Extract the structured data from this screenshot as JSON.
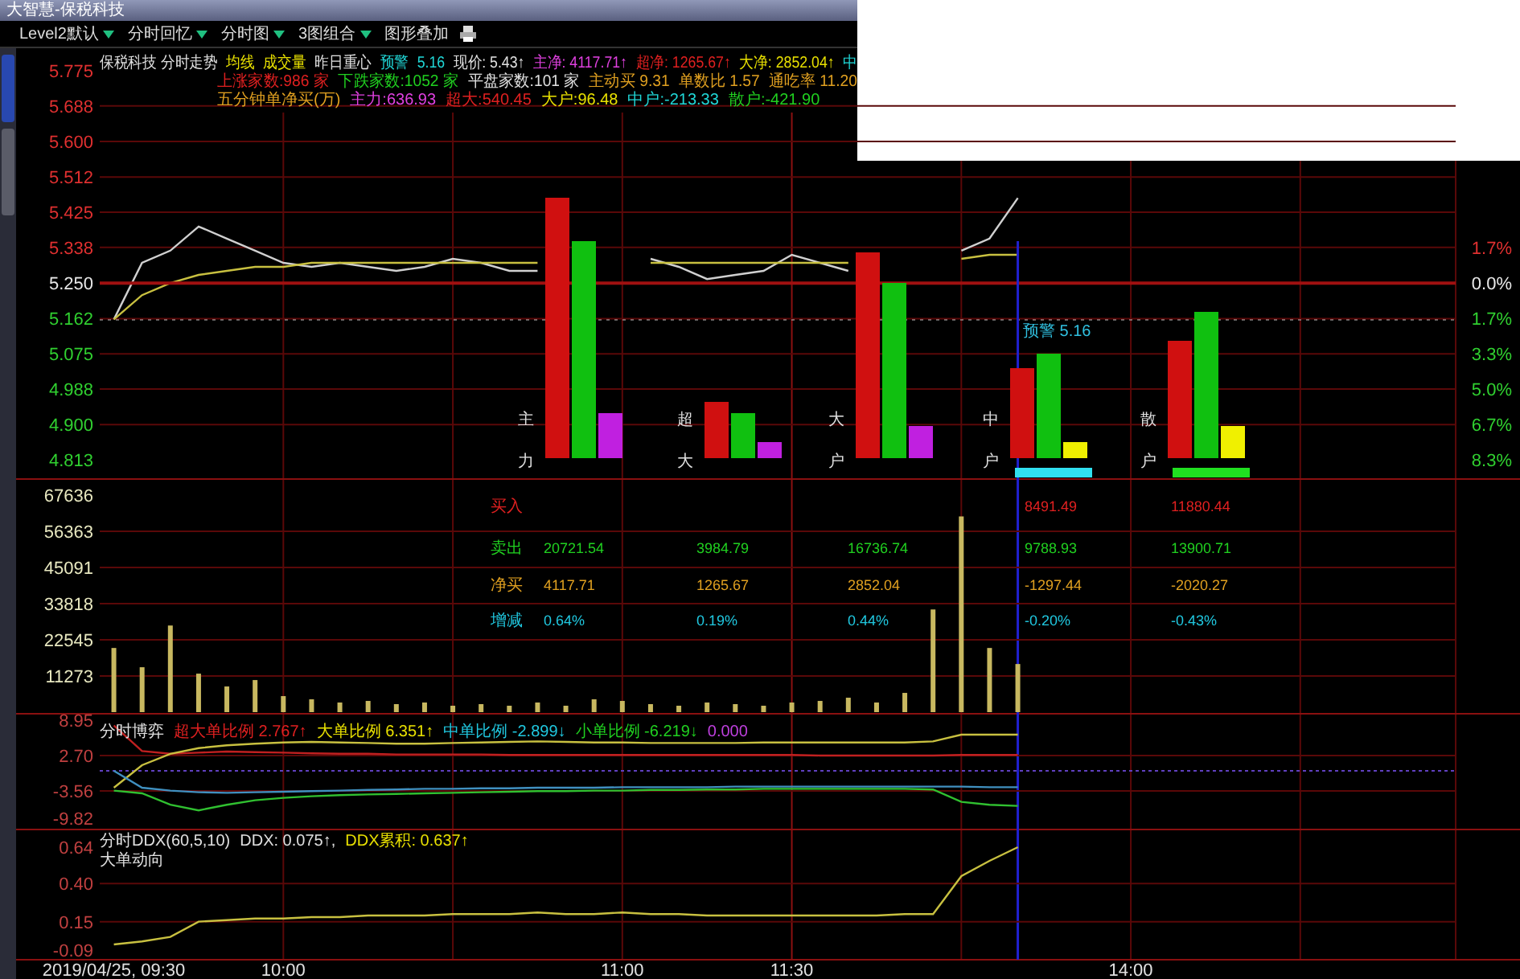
{
  "window": {
    "title": "大智慧-保税科技"
  },
  "toolbar": {
    "items": [
      {
        "label": "Level2默认",
        "dropdown": true
      },
      {
        "label": "分时回忆",
        "dropdown": true
      },
      {
        "label": "分时图",
        "dropdown": true
      },
      {
        "label": "3图组合",
        "dropdown": true
      },
      {
        "label": "图形叠加",
        "dropdown": false
      }
    ]
  },
  "side_tabs": [
    {
      "selected": true
    },
    {
      "selected": false
    }
  ],
  "header": {
    "line_1": [
      {
        "text": "保税科技 分时走势",
        "color": "#e0e0e0"
      },
      {
        "text": "均线",
        "color": "#e8e000"
      },
      {
        "text": "成交量",
        "color": "#e8e000"
      },
      {
        "text": "昨日重心",
        "color": "#e0e0e0"
      },
      {
        "text": "预警",
        "color": "#20d8d8"
      },
      {
        "text": "5.16",
        "color": "#20d8d8"
      },
      {
        "text": "现价: 5.43↑",
        "color": "#e0e0e0"
      },
      {
        "text": "主净: 4117.71↑",
        "color": "#e040e0"
      },
      {
        "text": "超净: 1265.67↑",
        "color": "#e02020"
      },
      {
        "text": "大净: 2852.04↑",
        "color": "#e8e000"
      },
      {
        "text": "中",
        "color": "#20d8d8"
      }
    ],
    "line_2": [
      {
        "text": "上涨家数:986 家",
        "color": "#e02020"
      },
      {
        "text": "下跌家数:1052 家",
        "color": "#20d020"
      },
      {
        "text": "平盘家数:101 家",
        "color": "#e0e0e0"
      },
      {
        "text": "主动买 9.31",
        "color": "#e0a020"
      },
      {
        "text": "单数比 1.57",
        "color": "#e0a020"
      },
      {
        "text": "通吃率 11.20",
        "color": "#e0a020"
      }
    ],
    "line_3": [
      {
        "text": "五分钟单净买(万)",
        "color": "#e0a020"
      },
      {
        "text": "主力:636.93",
        "color": "#e040e0"
      },
      {
        "text": "超大:540.45",
        "color": "#e02020"
      },
      {
        "text": "大户:96.48",
        "color": "#e8e000"
      },
      {
        "text": "中户:-213.33",
        "color": "#20d8d8"
      },
      {
        "text": "散户:-421.90",
        "color": "#20d020"
      }
    ]
  },
  "price_panel": {
    "tick_colors": [
      {
        "color": "#e03030"
      },
      {
        "color": "#e03030"
      },
      {
        "color": "#e03030"
      },
      {
        "color": "#e03030"
      },
      {
        "color": "#e03030"
      },
      {
        "color": "#e03030"
      },
      {
        "color": "#e8e8e8"
      },
      {
        "color": "#30d030"
      },
      {
        "color": "#30d030"
      },
      {
        "color": "#30d030"
      },
      {
        "color": "#30d030"
      },
      {
        "color": "#30d030"
      }
    ],
    "change_labels": [
      {
        "label": "1.7%",
        "color": "#e03030"
      },
      {
        "label": "0.0%",
        "color": "#e8e8e8"
      },
      {
        "label": "1.7%",
        "color": "#30d030"
      },
      {
        "label": "3.3%",
        "color": "#30d030"
      },
      {
        "label": "5.0%",
        "color": "#30d030"
      },
      {
        "label": "6.7%",
        "color": "#30d030"
      },
      {
        "label": "8.3%",
        "color": "#30d030"
      }
    ],
    "alert_label": "预警 5.16",
    "chart_data": {
      "type": "line",
      "categories": [
        null,
        null,
        null,
        null,
        null,
        null,
        null,
        null,
        null,
        null,
        null,
        null,
        null,
        null,
        null,
        null,
        null,
        null,
        null,
        null,
        null,
        null,
        null,
        null,
        null,
        null,
        null,
        null,
        null,
        null,
        null,
        null,
        null,
        null,
        null,
        null,
        null,
        null,
        null,
        null,
        null,
        null,
        null,
        null,
        null,
        null,
        null,
        null
      ],
      "ylim": [
        4.813,
        5.775
      ],
      "grid": true,
      "yticks": [
        {
          "value": 5.775,
          "label": "5.775"
        },
        {
          "value": 5.688,
          "label": "5.688"
        },
        {
          "value": 5.6,
          "label": "5.600"
        },
        {
          "value": 5.512,
          "label": "5.512"
        },
        {
          "value": 5.425,
          "label": "5.425"
        },
        {
          "value": 5.338,
          "label": "5.338"
        },
        {
          "value": 5.25,
          "label": "5.250"
        },
        {
          "value": 5.162,
          "label": "5.162"
        },
        {
          "value": 5.075,
          "label": "5.075"
        },
        {
          "value": 4.988,
          "label": "4.988"
        },
        {
          "value": 4.9,
          "label": "4.900"
        },
        {
          "value": 4.813,
          "label": "4.813"
        }
      ],
      "series": [
        {
          "color": "#d0d0d0",
          "values": [
            5.16,
            5.3,
            5.33,
            5.39,
            5.36,
            5.33,
            5.3,
            5.29,
            5.3,
            5.29,
            5.28,
            5.29,
            5.31,
            5.3,
            5.28,
            5.28,
            null,
            null,
            null,
            5.31,
            5.29,
            5.26,
            5.27,
            5.28,
            5.32,
            5.3,
            5.28,
            null,
            null,
            null,
            5.33,
            5.36,
            5.46,
            null,
            null,
            null,
            null,
            null,
            null,
            null,
            null,
            null,
            null,
            null,
            null,
            null,
            null,
            null
          ]
        },
        {
          "color": "#c8c040",
          "values": [
            5.16,
            5.22,
            5.25,
            5.27,
            5.28,
            5.29,
            5.29,
            5.3,
            5.3,
            5.3,
            5.3,
            5.3,
            5.3,
            5.3,
            5.3,
            5.3,
            null,
            null,
            null,
            5.3,
            5.3,
            5.3,
            5.3,
            5.3,
            5.3,
            5.3,
            5.3,
            null,
            null,
            null,
            5.31,
            5.32,
            5.32,
            null,
            null,
            null,
            null,
            null,
            null,
            null,
            null,
            null,
            null,
            null,
            null,
            null,
            null,
            null
          ]
        }
      ]
    }
  },
  "funds_overlay": {
    "groups": [
      {
        "top": "主",
        "bottom": "力"
      },
      {
        "top": "超",
        "bottom": "大"
      },
      {
        "top": "大",
        "bottom": "户"
      },
      {
        "top": "中",
        "bottom": "户"
      },
      {
        "top": "散",
        "bottom": "户"
      }
    ],
    "table": [
      {
        "label": "买入",
        "kind": "buy",
        "cells": [
          null,
          null,
          null,
          "8491.49",
          "11880.44"
        ]
      },
      {
        "label": "卖出",
        "kind": "sell",
        "cells": [
          "20721.54",
          "3984.79",
          "16736.74",
          "9788.93",
          "13900.71"
        ]
      },
      {
        "label": "净买",
        "kind": "net",
        "cells": [
          "4117.71",
          "1265.67",
          "2852.04",
          "-1297.44",
          "-2020.27"
        ]
      },
      {
        "label": "增减",
        "kind": "change",
        "cells": [
          "0.64%",
          "0.19%",
          "0.44%",
          "-0.20%",
          "-0.43%"
        ]
      }
    ]
  },
  "volume_panel": {
    "chart_data": {
      "type": "bar",
      "categories": [
        null,
        null,
        null,
        null,
        null,
        null,
        null,
        null,
        null,
        null,
        null,
        null,
        null,
        null,
        null,
        null,
        null,
        null,
        null,
        null,
        null,
        null,
        null,
        null,
        null,
        null,
        null,
        null,
        null,
        null,
        null,
        null,
        null,
        null,
        null,
        null,
        null,
        null,
        null,
        null,
        null,
        null,
        null,
        null,
        null,
        null,
        null,
        null
      ],
      "ylim": [
        0,
        67636
      ],
      "grid": true,
      "yticks": [
        67636,
        56363,
        45091,
        33818,
        22545,
        11273
      ],
      "values": [
        20000,
        14000,
        27000,
        12000,
        8000,
        10000,
        5000,
        4000,
        3000,
        3500,
        2500,
        3000,
        2000,
        2500,
        2000,
        3000,
        2000,
        4000,
        3500,
        2500,
        2000,
        3000,
        2500,
        2000,
        3000,
        3500,
        4500,
        3000,
        6000,
        32000,
        61000,
        20000,
        15000,
        null,
        null,
        null,
        null,
        null,
        null,
        null,
        null,
        null,
        null,
        null,
        null,
        null,
        null,
        null
      ]
    }
  },
  "game_panel": {
    "legend": [
      {
        "text": "分时博弈",
        "color": "#e0e0e0"
      },
      {
        "text": "超大单比例 2.767↑",
        "color": "#e02020"
      },
      {
        "text": "大单比例 6.351↑",
        "color": "#e8e000"
      },
      {
        "text": "中单比例 -2.899↓",
        "color": "#20c8e0"
      },
      {
        "text": "小单比例 -6.219↓",
        "color": "#20d020"
      },
      {
        "text": "0.000",
        "color": "#c040e0"
      }
    ],
    "chart_data": {
      "type": "line",
      "categories": [
        null,
        null,
        null,
        null,
        null,
        null,
        null,
        null,
        null,
        null,
        null,
        null,
        null,
        null,
        null,
        null,
        null,
        null,
        null,
        null,
        null,
        null,
        null,
        null,
        null,
        null,
        null,
        null,
        null,
        null,
        null,
        null,
        null,
        null,
        null,
        null,
        null,
        null,
        null,
        null,
        null,
        null,
        null,
        null,
        null,
        null,
        null,
        null
      ],
      "ylim": [
        -9.82,
        8.95
      ],
      "grid": true,
      "yticks": [
        {
          "value": 8.95,
          "label": "8.95"
        },
        {
          "value": 2.7,
          "label": "2.70"
        },
        {
          "value": -3.56,
          "label": "-3.56"
        },
        {
          "value": -9.82,
          "label": "-9.82"
        }
      ],
      "series": [
        {
          "color": "#c02020",
          "values": [
            8.0,
            3.5,
            3.0,
            3.2,
            3.4,
            3.3,
            3.2,
            3.1,
            3.0,
            3.0,
            2.9,
            2.9,
            2.9,
            2.9,
            2.8,
            2.8,
            2.8,
            2.8,
            2.8,
            2.8,
            2.8,
            2.8,
            2.8,
            2.8,
            2.8,
            2.7,
            2.7,
            2.7,
            2.7,
            2.7,
            2.8,
            2.8,
            2.8,
            null,
            null,
            null,
            null,
            null,
            null,
            null,
            null,
            null,
            null,
            null,
            null,
            null,
            null,
            null
          ]
        },
        {
          "color": "#c8c040",
          "values": [
            -3.0,
            1.0,
            3.0,
            4.0,
            4.5,
            4.8,
            5.0,
            5.1,
            5.0,
            4.9,
            4.8,
            4.8,
            4.9,
            5.0,
            5.1,
            5.2,
            5.1,
            5.0,
            5.0,
            4.9,
            4.9,
            4.9,
            4.9,
            5.0,
            5.0,
            5.0,
            5.0,
            5.0,
            5.0,
            5.2,
            6.4,
            6.4,
            6.4,
            null,
            null,
            null,
            null,
            null,
            null,
            null,
            null,
            null,
            null,
            null,
            null,
            null,
            null,
            null
          ]
        },
        {
          "color": "#4090c0",
          "values": [
            0,
            -3.0,
            -3.5,
            -3.8,
            -3.9,
            -3.8,
            -3.7,
            -3.6,
            -3.5,
            -3.4,
            -3.3,
            -3.2,
            -3.2,
            -3.1,
            -3.1,
            -3.0,
            -3.0,
            -3.0,
            -2.9,
            -2.9,
            -2.9,
            -2.9,
            -2.8,
            -2.8,
            -2.8,
            -2.8,
            -2.8,
            -2.8,
            -2.8,
            -2.8,
            -2.8,
            -2.9,
            -2.9,
            null,
            null,
            null,
            null,
            null,
            null,
            null,
            null,
            null,
            null,
            null,
            null,
            null,
            null,
            null
          ]
        },
        {
          "color": "#30c030",
          "values": [
            -3.5,
            -4.0,
            -6.0,
            -7.0,
            -6.0,
            -5.2,
            -4.8,
            -4.5,
            -4.3,
            -4.2,
            -4.1,
            -4.0,
            -3.9,
            -3.8,
            -3.7,
            -3.6,
            -3.6,
            -3.5,
            -3.5,
            -3.4,
            -3.4,
            -3.3,
            -3.3,
            -3.2,
            -3.2,
            -3.2,
            -3.2,
            -3.2,
            -3.2,
            -3.3,
            -5.5,
            -6.0,
            -6.2,
            null,
            null,
            null,
            null,
            null,
            null,
            null,
            null,
            null,
            null,
            null,
            null,
            null,
            null,
            null
          ]
        }
      ]
    }
  },
  "ddx_panel": {
    "legend": [
      {
        "text": "分时DDX(60,5,10)",
        "color": "#e0e0e0"
      },
      {
        "text": "DDX: 0.075↑,",
        "color": "#e0e0e0"
      },
      {
        "text": "DDX累积: 0.637↑",
        "color": "#e8e000"
      }
    ],
    "subtitle": "大单动向",
    "chart_data": {
      "type": "line",
      "categories": [
        "2019/04/25, 09:30",
        null,
        null,
        null,
        null,
        null,
        "10:00",
        null,
        null,
        null,
        null,
        null,
        null,
        null,
        null,
        null,
        null,
        null,
        "11:00",
        null,
        null,
        null,
        null,
        null,
        "11:30",
        null,
        null,
        null,
        null,
        null,
        null,
        null,
        null,
        null,
        null,
        null,
        "14:00",
        null,
        null,
        null,
        null,
        null,
        null,
        null,
        null,
        null,
        null,
        null
      ],
      "ylim": [
        -0.09,
        0.64
      ],
      "grid": true,
      "yticks": [
        {
          "value": 0.64,
          "label": "0.64"
        },
        {
          "value": 0.4,
          "label": "0.40"
        },
        {
          "value": 0.15,
          "label": "0.15"
        },
        {
          "value": -0.09,
          "label": "-0.09"
        }
      ],
      "series": [
        {
          "color": "#c8c040",
          "values": [
            0.0,
            0.02,
            0.05,
            0.15,
            0.16,
            0.17,
            0.17,
            0.18,
            0.18,
            0.19,
            0.19,
            0.19,
            0.2,
            0.2,
            0.2,
            0.21,
            0.2,
            0.2,
            0.21,
            0.2,
            0.2,
            0.19,
            0.19,
            0.19,
            0.19,
            0.19,
            0.19,
            0.19,
            0.2,
            0.2,
            0.45,
            0.55,
            0.64,
            null,
            null,
            null,
            null,
            null,
            null,
            null,
            null,
            null,
            null,
            null,
            null,
            null,
            null,
            null
          ]
        }
      ]
    }
  }
}
